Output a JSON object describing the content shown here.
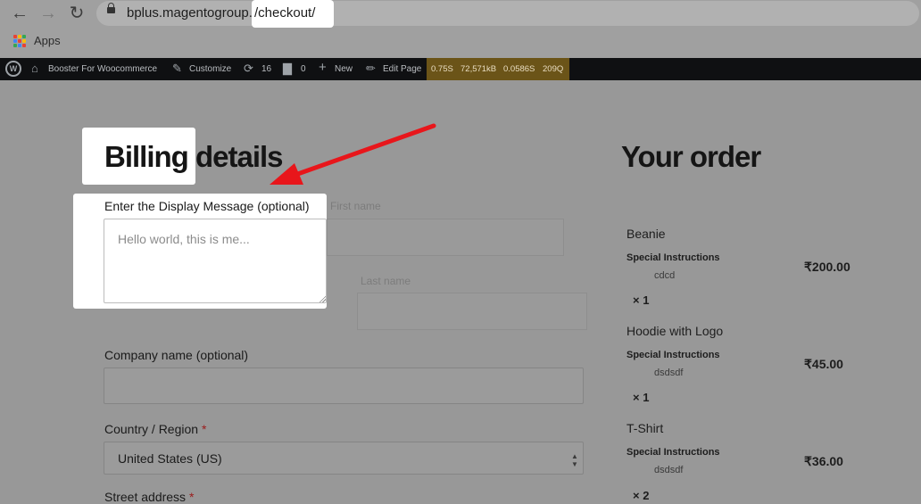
{
  "browser": {
    "url_host": "bplus.magentogroup.in",
    "url_path": "/checkout/",
    "bookmarks_apps": "Apps",
    "apps_colors": [
      "#e94235",
      "#fbbc04",
      "#34a853",
      "#4285f4",
      "#e94235",
      "#fbbc04",
      "#34a853",
      "#4285f4",
      "#e94235"
    ]
  },
  "admin_bar": {
    "site_name": "Booster For Woocommerce",
    "customize": "Customize",
    "updates_count": "16",
    "comments_count": "0",
    "new_label": "New",
    "edit_page": "Edit Page",
    "stats": [
      "0.75S",
      "72,571kB",
      "0.0586S",
      "209Q"
    ]
  },
  "billing": {
    "heading": "Billing details",
    "popup": {
      "label": "Enter the Display Message (optional)",
      "placeholder": "Hello world, this is me..."
    },
    "ghost_first_name": "First name",
    "ghost_last_name": "Last name",
    "company_label": "Company name (optional)",
    "country_label": "Country / Region",
    "country_value": "United States (US)",
    "street_label": "Street address",
    "required_mark": "*"
  },
  "order": {
    "heading": "Your order",
    "meta_label": "Special Instructions",
    "items": [
      {
        "name": "Beanie",
        "instructions": "cdcd",
        "qty": "× 1",
        "price": "₹200.00"
      },
      {
        "name": "Hoodie with Logo",
        "instructions": "dsdsdf",
        "qty": "× 1",
        "price": "₹45.00"
      },
      {
        "name": "T-Shirt",
        "instructions": "dsdsdf",
        "qty": "× 2",
        "price": "₹36.00"
      }
    ]
  },
  "colors": {
    "arrow": "#e8161b",
    "admin_bar": "#0f1012",
    "stats_bar": "#6b5418"
  }
}
